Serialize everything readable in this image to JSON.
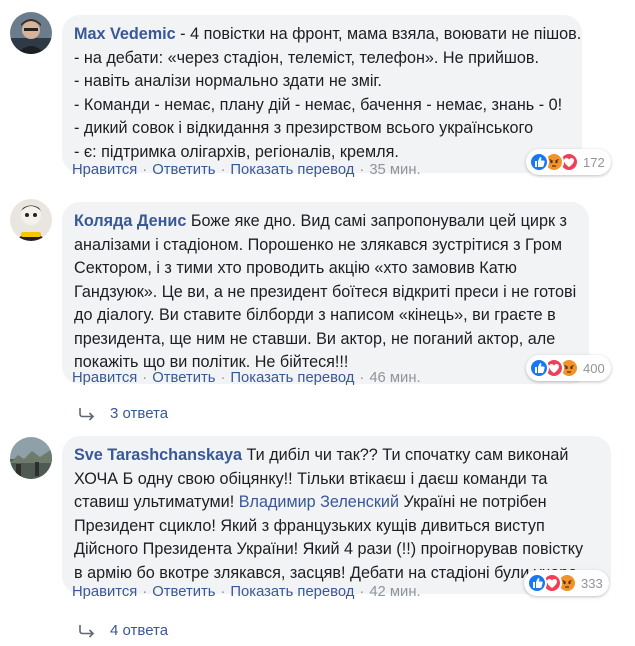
{
  "comments": [
    {
      "author": "Max Vedemic",
      "lines": [
        " - 4 повістки на фронт, мама взяла, воювати не пішов.",
        "- на дебати: «через стадіон, телеміст, телефон». Не прийшов.",
        "- навіть аналізи нормально здати не зміг.",
        "- Команди - немає, плану дій - немає, бачення - немає, знань - 0!",
        "- дикий совок і відкидання з презирством всього українського",
        "- є: підтримка олігархів, регіоналів, кремля."
      ],
      "actions": {
        "like": "Нравится",
        "reply": "Ответить",
        "translate": "Показать перевод",
        "time": "35 мин."
      },
      "reaction_count": "172"
    },
    {
      "author": "Коляда Денис",
      "lines": [
        " Боже яке дно. Вид самі запропонували цей цирк з",
        "аналізами і стадіоном. Порошенко не злякався зустрітися з Гром",
        "Сектором, і з тими хто проводить акцію «хто замовив Катю",
        "Гандзуюк». Це ви, а не президент боїтеся відкриті преси і не готові",
        "до діалогу. Ви ставите білборди з написом «кінець», ви граєте в",
        "президента, ще ним не ставши. Ви актор, не поганий актор, але",
        "покажіть що ви політик. Не бійтеся!!!"
      ],
      "actions": {
        "like": "Нравится",
        "reply": "Ответить",
        "translate": "Показать перевод",
        "time": "46 мин."
      },
      "reaction_count": "400",
      "replies": "3 ответа"
    },
    {
      "author": "Sve Tarashchanskaya",
      "line1": " Ти дибіл чи так?? Ти спочатку сам виконай",
      "line2": "ХОЧА Б одну свою обіцянку!! Тільки втікаєш і даєш команди та",
      "line3_pre": "ставиш ультиматуми! ",
      "mention": "Владимир Зеленский",
      "line3_post": " Україні не потрібен",
      "lines_rest": [
        "Президент сцикло! Який з французьких кущів дивиться виступ",
        "Дійсного Президента України! Який 4 рази (!!) проігнорував повістку",
        "в армію бо вкотре злякався, засцяв! Дебати на стадіоні були учора."
      ],
      "actions": {
        "like": "Нравится",
        "reply": "Ответить",
        "translate": "Показать перевод",
        "time": "42 мин."
      },
      "reaction_count": "333",
      "replies": "4 ответа"
    }
  ],
  "colors": {
    "link": "#385898",
    "bubble": "#f2f3f5",
    "meta": "#90949c",
    "like": "#1877f2",
    "love": "#f33e58",
    "angry": "#f0932b"
  },
  "reaction_icons": [
    "like-icon",
    "angry-icon",
    "love-icon"
  ]
}
